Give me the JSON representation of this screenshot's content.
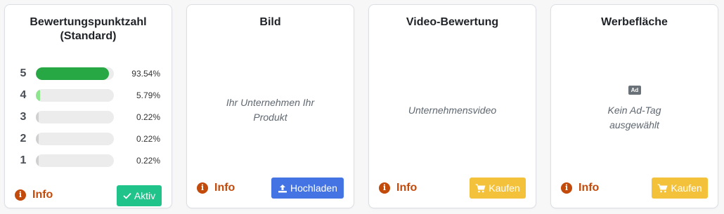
{
  "cards": {
    "rating": {
      "title": "Bewertungspunktzahl (Standard)",
      "rows": [
        {
          "stars": "5",
          "percent_label": "93.54%",
          "fraction": 0.9354,
          "color": "#28a745"
        },
        {
          "stars": "4",
          "percent_label": "5.79%",
          "fraction": 0.0579,
          "color": "#8ee58e"
        },
        {
          "stars": "3",
          "percent_label": "0.22%",
          "fraction": 0.0022,
          "color": "#d0d0d0"
        },
        {
          "stars": "2",
          "percent_label": "0.22%",
          "fraction": 0.0022,
          "color": "#d0d0d0"
        },
        {
          "stars": "1",
          "percent_label": "0.22%",
          "fraction": 0.0022,
          "color": "#d0d0d0"
        }
      ],
      "info_label": "Info",
      "button_label": "Aktiv",
      "button_icon": "check-icon"
    },
    "image": {
      "title": "Bild",
      "placeholder": "Ihr Unternehmen Ihr Produkt",
      "info_label": "Info",
      "button_label": "Hochladen",
      "button_icon": "upload-icon"
    },
    "video": {
      "title": "Video-Bewertung",
      "placeholder": "Unternehmensvideo",
      "info_label": "Info",
      "button_label": "Kaufen",
      "button_icon": "cart-icon"
    },
    "ad": {
      "title": "Werbefläche",
      "badge": "Ad",
      "placeholder": "Kein Ad-Tag ausgewählt",
      "info_label": "Info",
      "button_label": "Kaufen",
      "button_icon": "cart-icon"
    }
  },
  "colors": {
    "info": "#c24a0b",
    "active_button": "#20c38a",
    "upload_button": "#4474e4",
    "buy_button": "#f3c13a"
  }
}
